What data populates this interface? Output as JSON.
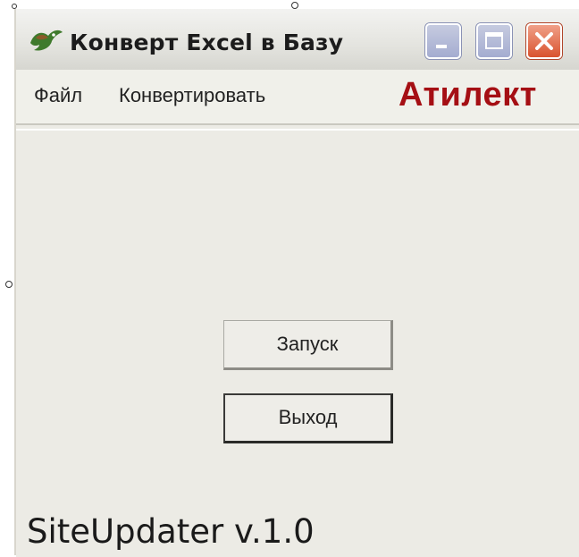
{
  "window": {
    "title": "Конверт Excel в Базу",
    "icon": "bird-app-icon",
    "controls": [
      "minimize-icon",
      "maximize-icon",
      "close-icon"
    ]
  },
  "menu": {
    "items": [
      "Файл",
      "Конвертировать"
    ]
  },
  "brand": {
    "text": "Атилект",
    "color": "#a50f14"
  },
  "buttons": {
    "start": "Запуск",
    "exit": "Выход"
  },
  "footer": {
    "version": "SiteUpdater v.1.0"
  },
  "colors": {
    "window_bg": "#ecebe5",
    "titlebar": "#e4e4df",
    "close_button": "#d9532f"
  }
}
